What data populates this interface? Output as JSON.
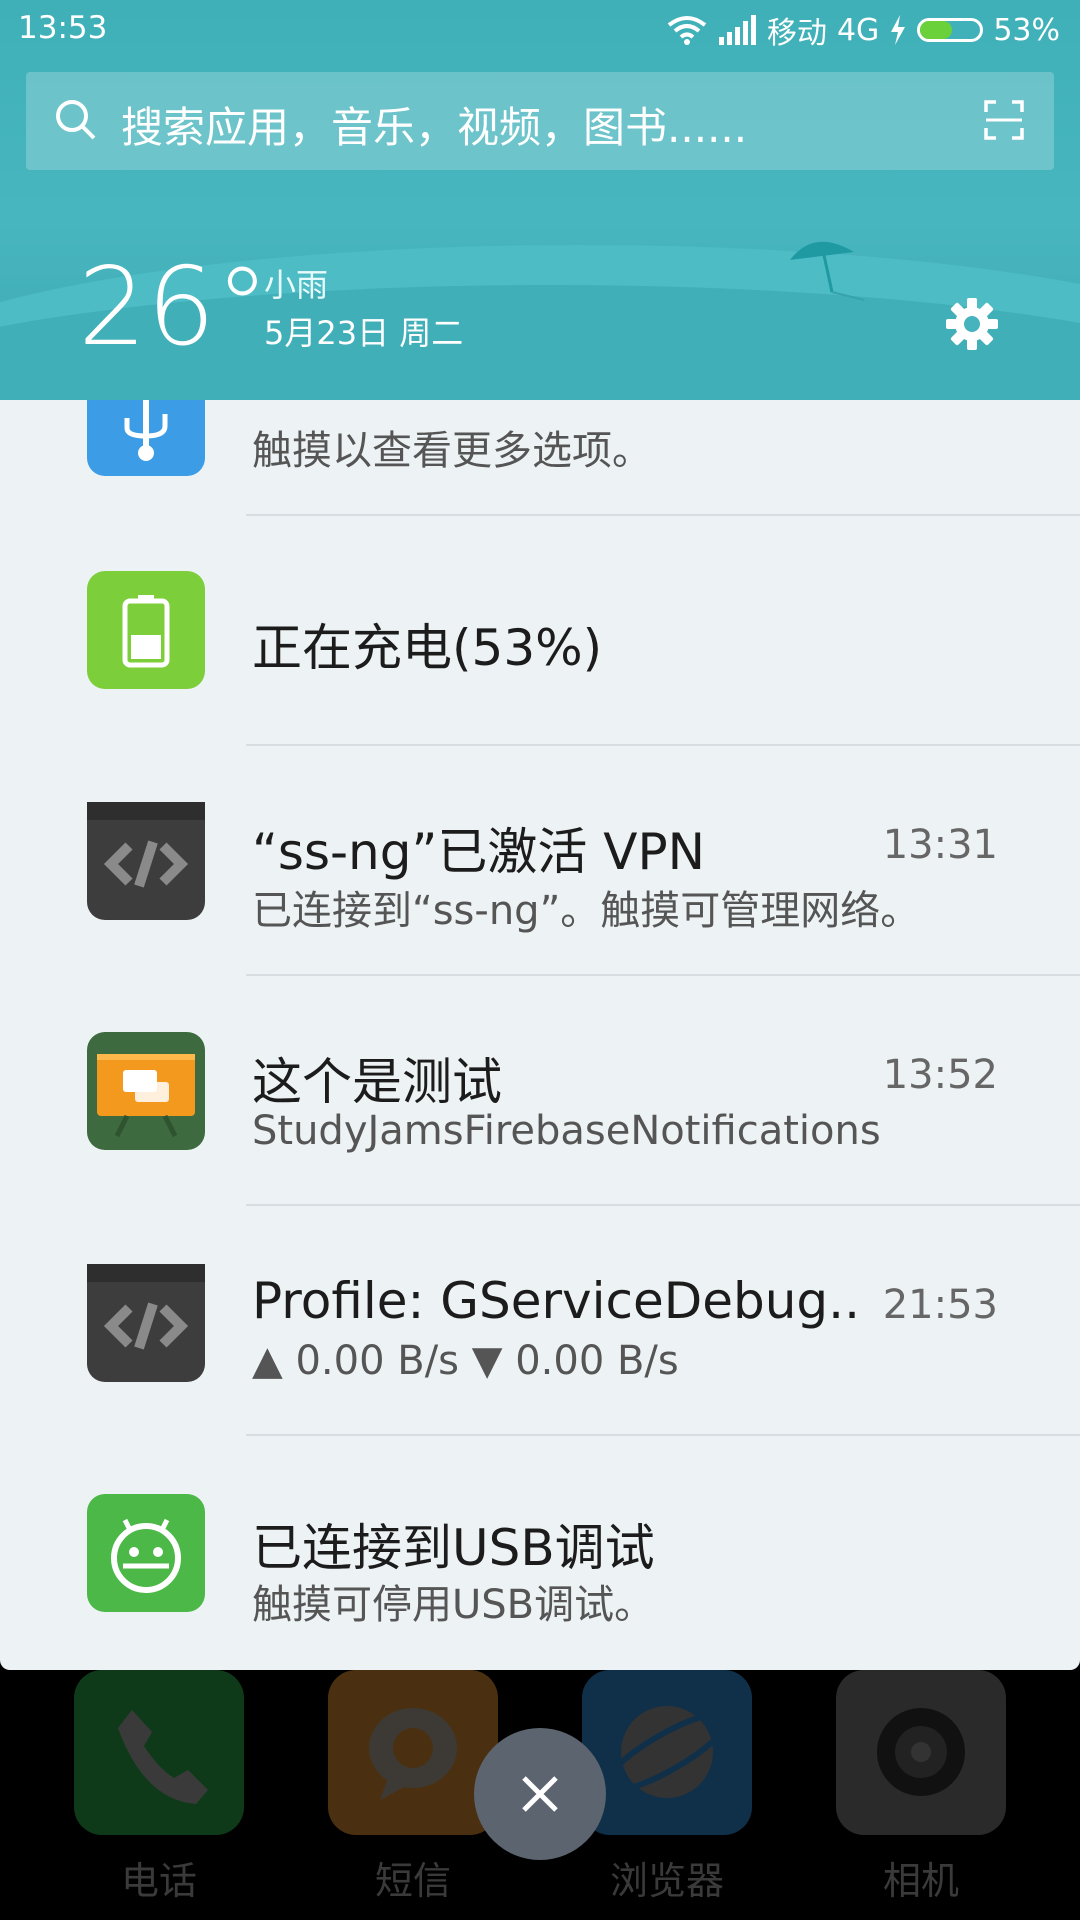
{
  "status_bar": {
    "time": "13:53",
    "carrier": "移动",
    "network": "4G",
    "battery_percent_text": "53%",
    "battery_level": 0.53
  },
  "search": {
    "placeholder": "搜索应用，音乐，视频，图书......"
  },
  "weather": {
    "temperature": "26°",
    "description": "小雨",
    "date": "5月23日 周二"
  },
  "notifications": [
    {
      "title": "",
      "subtitle": "触摸以查看更多选项。",
      "time": "",
      "icon": "usb-icon",
      "color": "#3d9ce6"
    },
    {
      "title": "正在充电(53%)",
      "subtitle": "",
      "time": "",
      "icon": "battery-charging-icon",
      "color": "#7ccf3a"
    },
    {
      "title": "“ss-ng”已激活 VPN",
      "subtitle": "已连接到“ss-ng”。触摸可管理网络。",
      "time": "13:31",
      "icon": "vpn-app-icon",
      "color": "#3d3d3d"
    },
    {
      "title": "这个是测试",
      "subtitle": "StudyJamsFirebaseNotifications",
      "time": "13:52",
      "icon": "firebase-notification-icon",
      "color": "#3d6b3f"
    },
    {
      "title": "Profile: GServiceDebug..",
      "subtitle": "▲ 0.00 B/s   ▼ 0.00 B/s",
      "time": "21:53",
      "icon": "vpn-app-icon",
      "color": "#3d3d3d"
    },
    {
      "title": "已连接到USB调试",
      "subtitle": "触摸可停用USB调试。",
      "time": "",
      "icon": "android-debug-icon",
      "color": "#4cb847"
    }
  ],
  "dock": [
    {
      "label": "电话",
      "icon": "phone-icon",
      "color": "#0f3a1a"
    },
    {
      "label": "短信",
      "icon": "message-icon",
      "color": "#4a3010"
    },
    {
      "label": "浏览器",
      "icon": "browser-icon",
      "color": "#10304a"
    },
    {
      "label": "相机",
      "icon": "camera-icon",
      "color": "#2a2a2a"
    }
  ]
}
